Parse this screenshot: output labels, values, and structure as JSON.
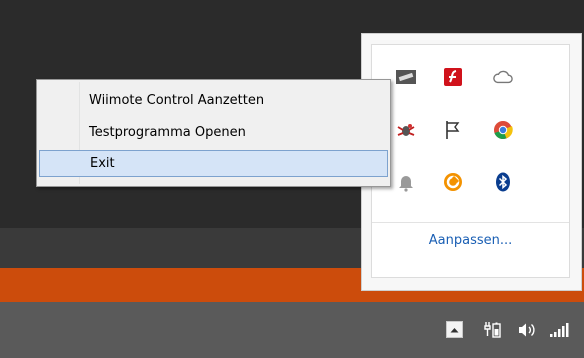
{
  "context_menu": {
    "items": [
      {
        "label": "Wiimote Control Aanzetten",
        "selected": false
      },
      {
        "label": "Testprogramma Openen",
        "selected": false
      },
      {
        "label": "Exit",
        "selected": true
      }
    ]
  },
  "tray_flyout": {
    "customize_label": "Aanpassen...",
    "icons": [
      "usb-device-icon",
      "flash-red-icon",
      "cloud-icon",
      "bug-icon",
      "flag-icon",
      "chrome-icon",
      "bell-icon",
      "orange-ring-icon",
      "bluetooth-icon"
    ]
  },
  "colors": {
    "accent_orange": "#cc4c0c",
    "taskbar": "#5a5a5a",
    "selection_bg": "#d5e4f7",
    "selection_border": "#7da2ce",
    "link": "#1a5fb4"
  }
}
